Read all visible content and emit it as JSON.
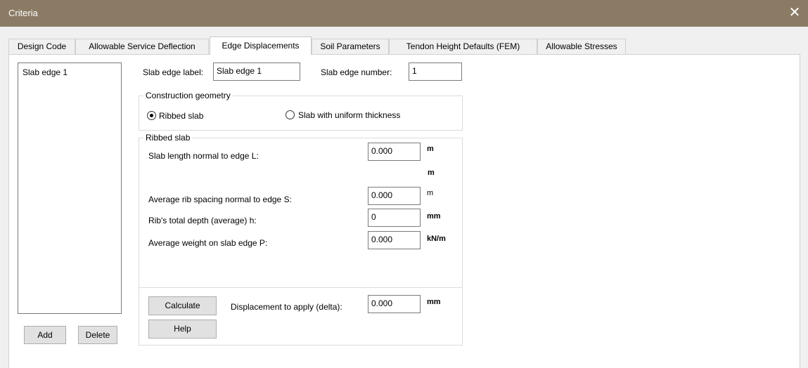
{
  "window": {
    "title": "Criteria",
    "close_glyph": "✕"
  },
  "tabs": [
    {
      "label": "Design Code",
      "active": false
    },
    {
      "label": "Allowable Service Deflection",
      "active": false
    },
    {
      "label": "Edge Displacements",
      "active": true
    },
    {
      "label": "Soil Parameters",
      "active": false
    },
    {
      "label": "Tendon Height Defaults (FEM)",
      "active": false
    },
    {
      "label": "Allowable Stresses",
      "active": false
    }
  ],
  "edge_list": {
    "items": [
      "Slab edge 1"
    ]
  },
  "buttons": {
    "add": "Add",
    "delete": "Delete",
    "calculate": "Calculate",
    "help": "Help"
  },
  "slab_edge": {
    "label_caption": "Slab edge label:",
    "label_value": "Slab edge 1",
    "number_caption": "Slab edge number:",
    "number_value": "1"
  },
  "construction_geometry": {
    "title": "Construction geometry",
    "options": [
      {
        "label": "Ribbed slab",
        "checked": true
      },
      {
        "label": "Slab with uniform thickness",
        "checked": false
      }
    ]
  },
  "ribbed_slab": {
    "title": "Ribbed slab",
    "fields": {
      "length": {
        "label": "Slab length normal to edge L:",
        "value": "0.000",
        "unit": "m"
      },
      "extra_unit": "m",
      "spacing": {
        "label": "Average rib spacing normal to edge S:",
        "value": "0.000",
        "unit": "m"
      },
      "depth": {
        "label": "Rib's total depth (average) h:",
        "value": "0",
        "unit": "mm"
      },
      "weight": {
        "label": "Average weight on slab edge P:",
        "value": "0.000",
        "unit": "kN/m"
      }
    },
    "displacement": {
      "label": "Displacement to apply (delta):",
      "value": "0.000",
      "unit": "mm"
    }
  }
}
